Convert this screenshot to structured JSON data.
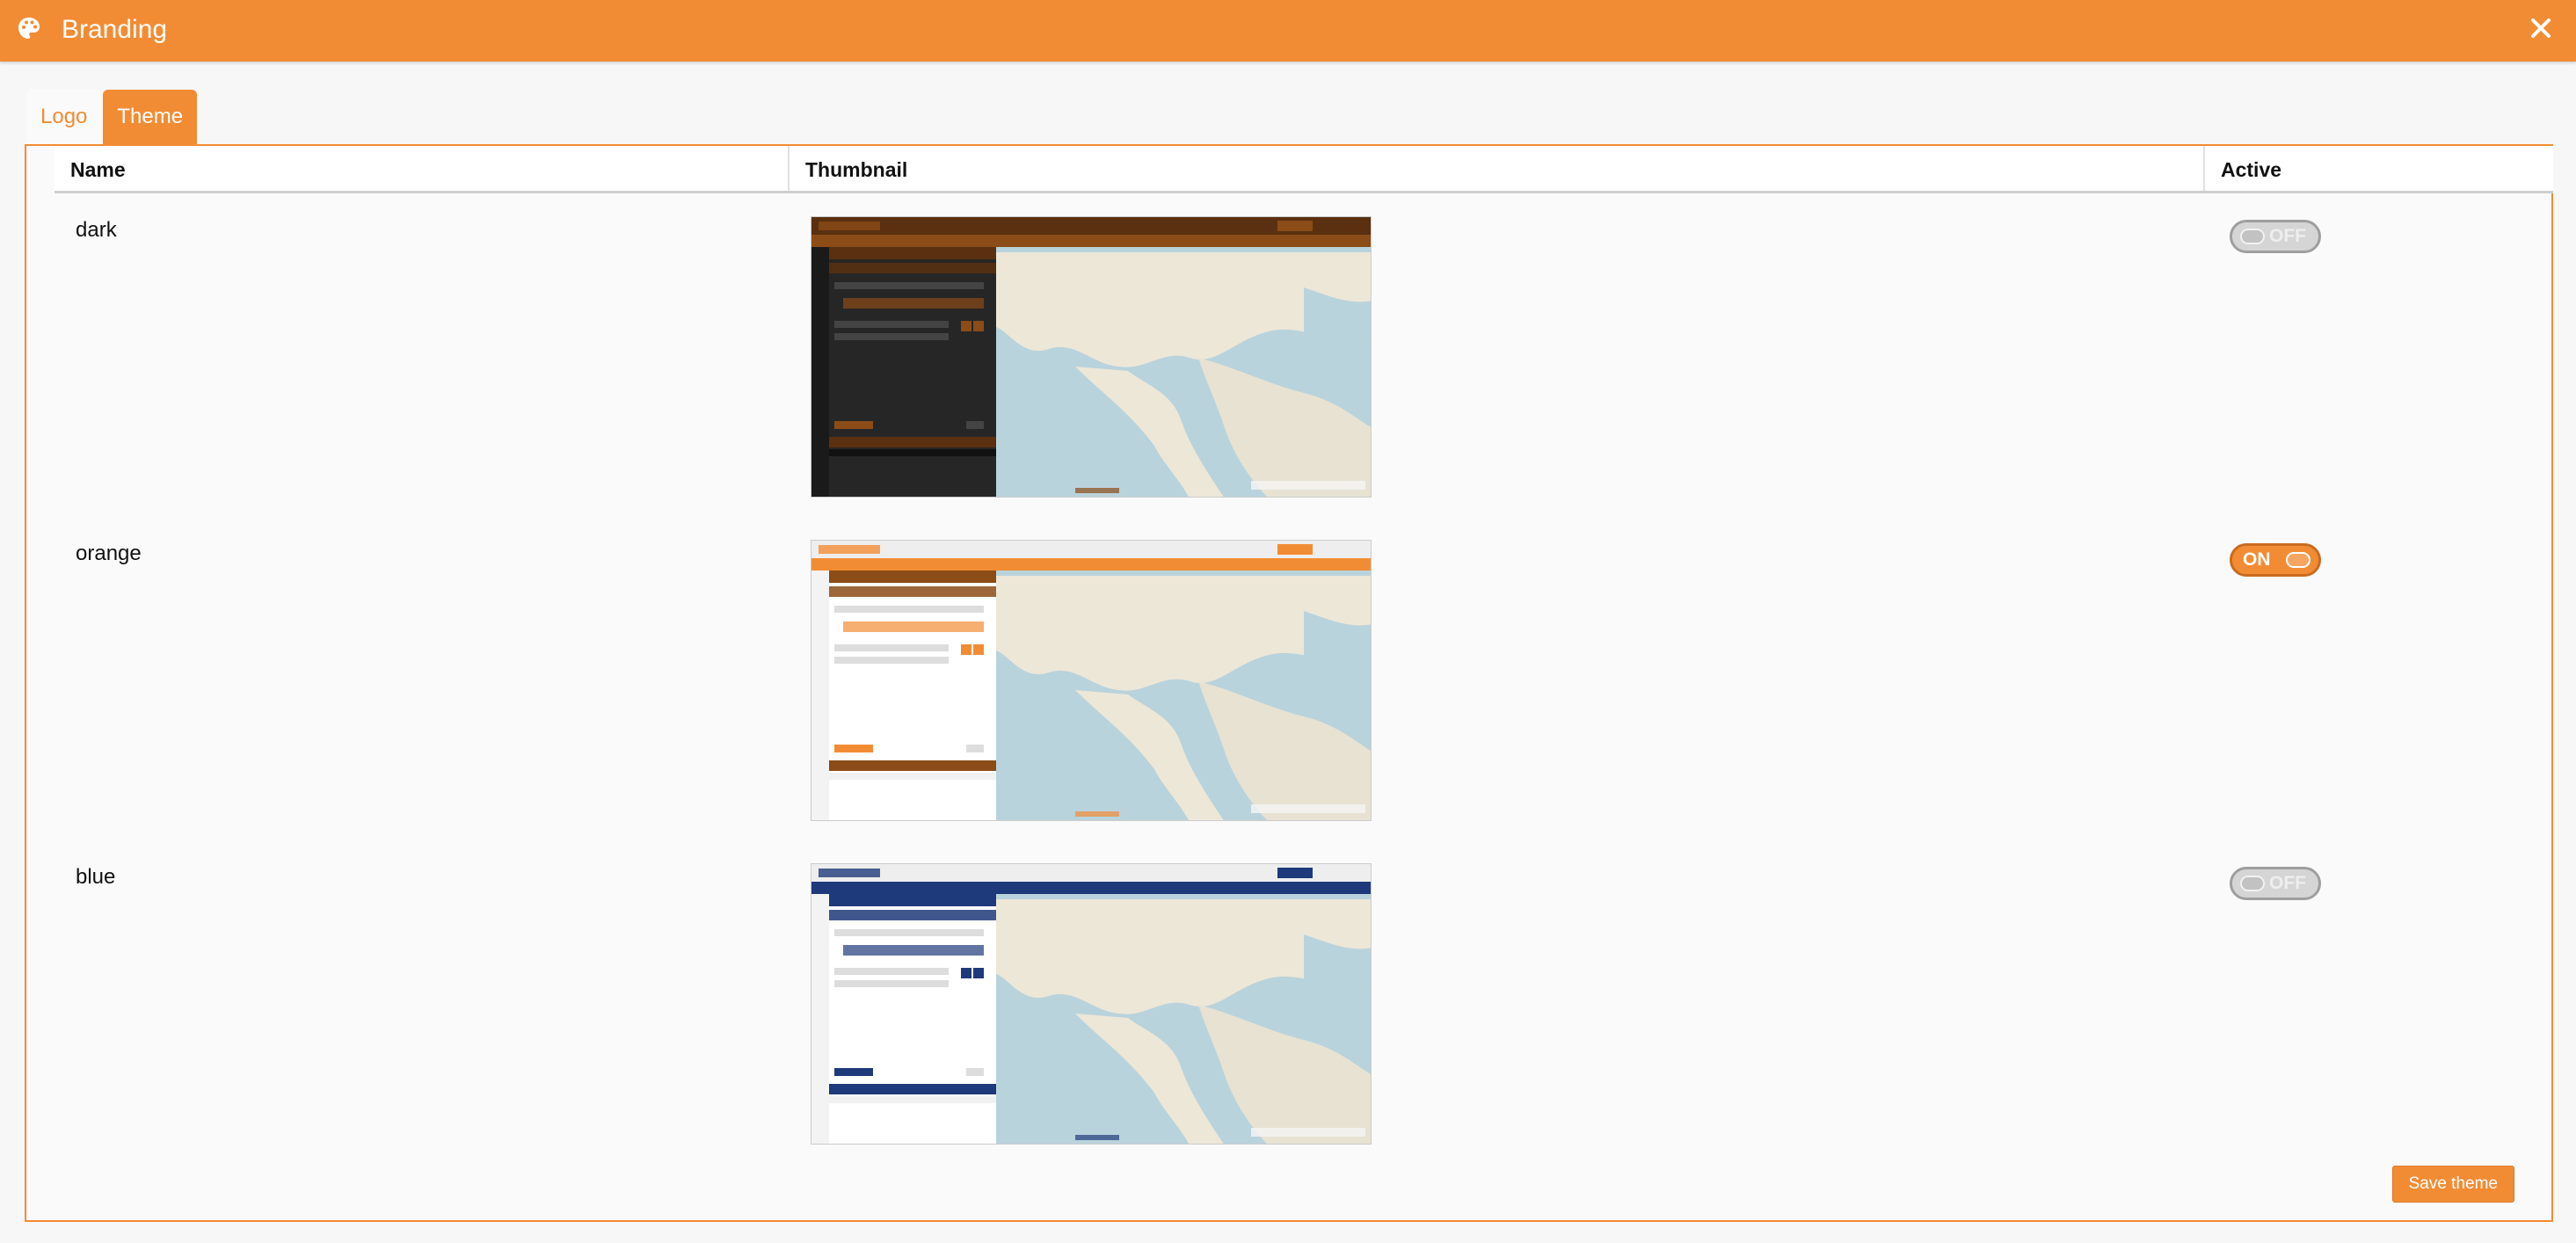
{
  "header": {
    "title": "Branding",
    "icon": "palette-icon",
    "close_icon": "close-icon"
  },
  "tabs": [
    {
      "label": "Logo",
      "active": false
    },
    {
      "label": "Theme",
      "active": true
    }
  ],
  "table": {
    "columns": [
      "Name",
      "Thumbnail",
      "Active"
    ],
    "rows": [
      {
        "name": "dark",
        "active_label": "OFF",
        "active": false,
        "accent": "#8b4c17",
        "panel_bg": "#262626",
        "bar": "#5a3010"
      },
      {
        "name": "orange",
        "active_label": "ON",
        "active": true,
        "accent": "#f28c34",
        "panel_bg": "#ffffff",
        "bar": "#8b4c17"
      },
      {
        "name": "blue",
        "active_label": "OFF",
        "active": false,
        "accent": "#1f3a7a",
        "panel_bg": "#ffffff",
        "bar": "#1f3a7a"
      }
    ]
  },
  "save_label": "Save theme",
  "colors": {
    "accent": "#f28c34",
    "toggle_off": "#d5d5d5"
  }
}
